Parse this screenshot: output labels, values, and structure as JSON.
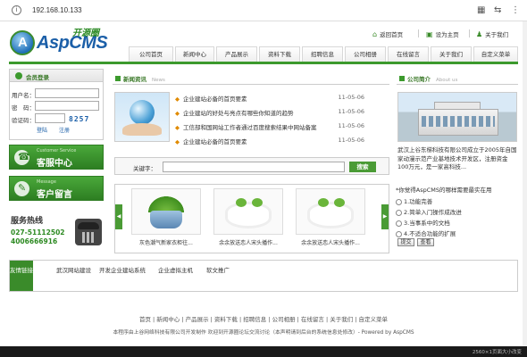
{
  "browser": {
    "url": "192.168.10.133"
  },
  "logo": {
    "name": "AspCMS",
    "badge": "开源圈",
    "mark": "A"
  },
  "toplinks": {
    "home": "返回首页",
    "fav": "设为主页",
    "contact": "关于我们"
  },
  "nav": [
    "公司首页",
    "新闻中心",
    "产品展示",
    "资料下载",
    "招聘信息",
    "公司相册",
    "在线留言",
    "关于我们",
    "自定义菜单"
  ],
  "login": {
    "title": "会员登录",
    "user_label": "用户名：",
    "pass_label": "密　码：",
    "code_label": "验证码：",
    "code": "8257",
    "login_btn": "登陆",
    "reg_btn": "注册"
  },
  "service": {
    "cs_small": "Customer Service",
    "cs_big": "客服中心",
    "msg_small": "Message",
    "msg_big": "客户留言",
    "hotline_title": "服务热线",
    "phone1": "027-51112502",
    "phone2": "4006666916"
  },
  "news": {
    "title": "新闻资讯",
    "sub": "News",
    "items": [
      {
        "title": "企业建站必备的首页要素",
        "date": "11-05-06"
      },
      {
        "title": "企业建站的好处与亮点有哪些你知道的趋势",
        "date": "11-05-06"
      },
      {
        "title": "工信部和国网站工作者通过百度搜索结果中网站备案",
        "date": "11-05-06"
      },
      {
        "title": "企业建站必备的首页要素",
        "date": "11-05-06"
      }
    ]
  },
  "search": {
    "label": "关键字：",
    "btn": "搜索"
  },
  "products": [
    {
      "caption": "灰色潮气新家衣柜往..."
    },
    {
      "caption": "余余放送恋人宋头播作..."
    },
    {
      "caption": "余余放送恋人宋头播作..."
    }
  ],
  "about": {
    "title": "公司简介",
    "sub": "About us",
    "text": "武汉上谷东梯科技有限公司成立于2005年自国家动漫示范产业基地技术开发区，注册资金100万元，是一家高科技...",
    "vote_q": "*你觉得AspCMS的哪样需要最实在用",
    "opts": [
      "功能完善",
      "简单入门操作成改进",
      "当事系中的文档",
      "不适合功能的扩展"
    ],
    "vote_btn": "提交",
    "view_btn": "查看"
  },
  "links": {
    "tag": "友情链接",
    "items": [
      "武汉网站建设",
      "开发企业建站系统",
      "企业虚拟主机",
      "软文推广"
    ]
  },
  "footer": {
    "nav": "首页 | 新闻中心 | 产品展示 | 资料下载 | 招聘信息 | 公司相册 | 在线留言 | 关于我们 | 自定义菜单",
    "copy": "本程序由上谷网络科技有限公司开发制作 欢迎到开源圈论坛交流讨论（本声明请到后台的系统信息处修改）- Powered by AspCMS"
  },
  "status": "2560×1页面大小改变"
}
